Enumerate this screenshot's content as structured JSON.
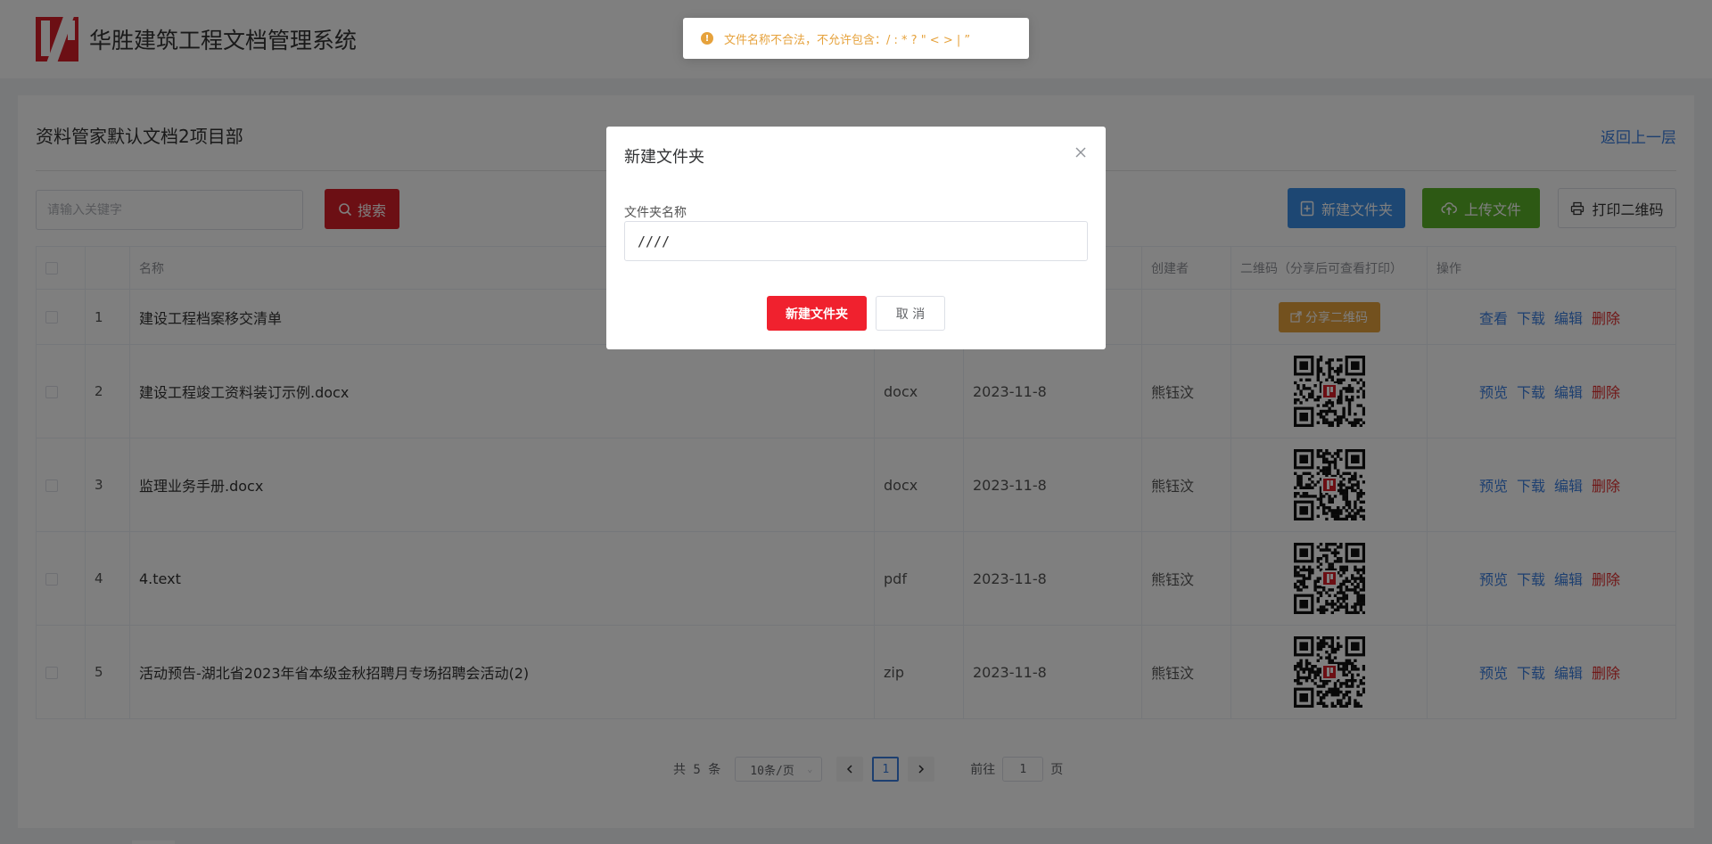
{
  "header": {
    "title": "华胜建筑工程文档管理系统"
  },
  "page": {
    "title": "资料管家默认文档2项目部",
    "back_label": "返回上一层"
  },
  "toolbar": {
    "search_placeholder": "请输入关键字",
    "search_label": "搜索",
    "new_folder_label": "新建文件夹",
    "upload_label": "上传文件",
    "print_qr_label": "打印二维码"
  },
  "table": {
    "headers": {
      "name": "名称",
      "creator": "创建者",
      "qr": "二维码（分享后可查看打印）",
      "ops": "操作"
    },
    "rows": [
      {
        "idx": "1",
        "name": "建设工程档案移交清单",
        "type": "",
        "date": "",
        "creator": "",
        "share_label": "分享二维码",
        "op1": "查看",
        "op2": "下载",
        "op3": "编辑",
        "op4": "删除"
      },
      {
        "idx": "2",
        "name": "建设工程竣工资料装订示例.docx",
        "type": "docx",
        "date": "2023-11-8",
        "creator": "熊钰汶",
        "op1": "预览",
        "op2": "下载",
        "op3": "编辑",
        "op4": "删除"
      },
      {
        "idx": "3",
        "name": "监理业务手册.docx",
        "type": "docx",
        "date": "2023-11-8",
        "creator": "熊钰汶",
        "op1": "预览",
        "op2": "下载",
        "op3": "编辑",
        "op4": "删除"
      },
      {
        "idx": "4",
        "name": "4.text",
        "type": "pdf",
        "date": "2023-11-8",
        "creator": "熊钰汶",
        "op1": "预览",
        "op2": "下载",
        "op3": "编辑",
        "op4": "删除"
      },
      {
        "idx": "5",
        "name": "活动预告-湖北省2023年省本级金秋招聘月专场招聘会活动(2)",
        "type": "zip",
        "date": "2023-11-8",
        "creator": "熊钰汶",
        "op1": "预览",
        "op2": "下载",
        "op3": "编辑",
        "op4": "删除"
      }
    ]
  },
  "pagination": {
    "total": "共 5 条",
    "page_size": "10条/页",
    "current": "1",
    "goto_prefix": "前往",
    "goto_value": "1",
    "goto_suffix": "页"
  },
  "dialog": {
    "title": "新建文件夹",
    "label": "文件夹名称",
    "input_value": "////",
    "ok_label": "新建文件夹",
    "cancel_label": "取 消"
  },
  "toast": {
    "message": "文件名称不合法，不允许包含：/ : * ? \" < > | ”"
  },
  "colors": {
    "brand": "#d81e28",
    "primary": "#3a8ee6",
    "success": "#5ab228",
    "warning": "#e6a23c",
    "link": "#3a7fe0",
    "danger": "#e02c2c"
  }
}
